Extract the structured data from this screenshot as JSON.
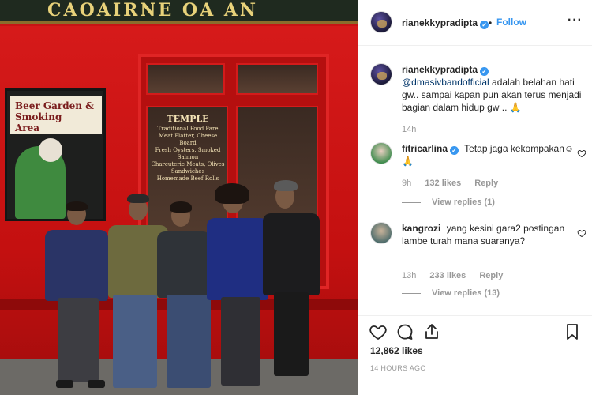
{
  "photo": {
    "sign_text": "CAOAIRNE  OA   AN",
    "poster_text": "Beer Garden &\nSmoking\nArea",
    "menu_title": "TEMPLE",
    "menu_lines": [
      "Traditional Food Fare",
      "Meat Platter, Cheese Board",
      "Fresh Oysters, Smoked Salmon",
      "Charcuterie Meats, Olives",
      "Sandwiches",
      "Homemade Beef Rolls"
    ]
  },
  "header": {
    "username": "rianekkypradipta",
    "separator": "•",
    "follow_label": "Follow",
    "more_icon": "more-horizontal-icon"
  },
  "comments": [
    {
      "username": "rianekkypradipta",
      "mention": "@dmasivbandofficial",
      "text": " adalah belahan hati gw.. sampai kapan pun akan terus menjadi bagian dalam hidup gw .. 🙏",
      "time": "14h"
    },
    {
      "username": "fitricarlina",
      "text": "Tetap jaga kekompakan☺ 🙏",
      "time": "9h",
      "likes": "132 likes",
      "reply": "Reply",
      "view_replies": "View replies (1)"
    },
    {
      "username": "kangrozi",
      "text": "yang kesini gara2 postingan lambe turah mana suaranya?",
      "time": "13h",
      "likes": "233 likes",
      "reply": "Reply",
      "view_replies": "View replies (13)"
    }
  ],
  "actions": {
    "icons": [
      "heart-icon",
      "comment-icon",
      "share-icon",
      "bookmark-icon"
    ],
    "likes": "12,862 likes",
    "time_ago": "14 HOURS AGO"
  },
  "colors": {
    "link": "#3897f0",
    "mention": "#003569",
    "muted": "#999999",
    "text": "#262626"
  }
}
